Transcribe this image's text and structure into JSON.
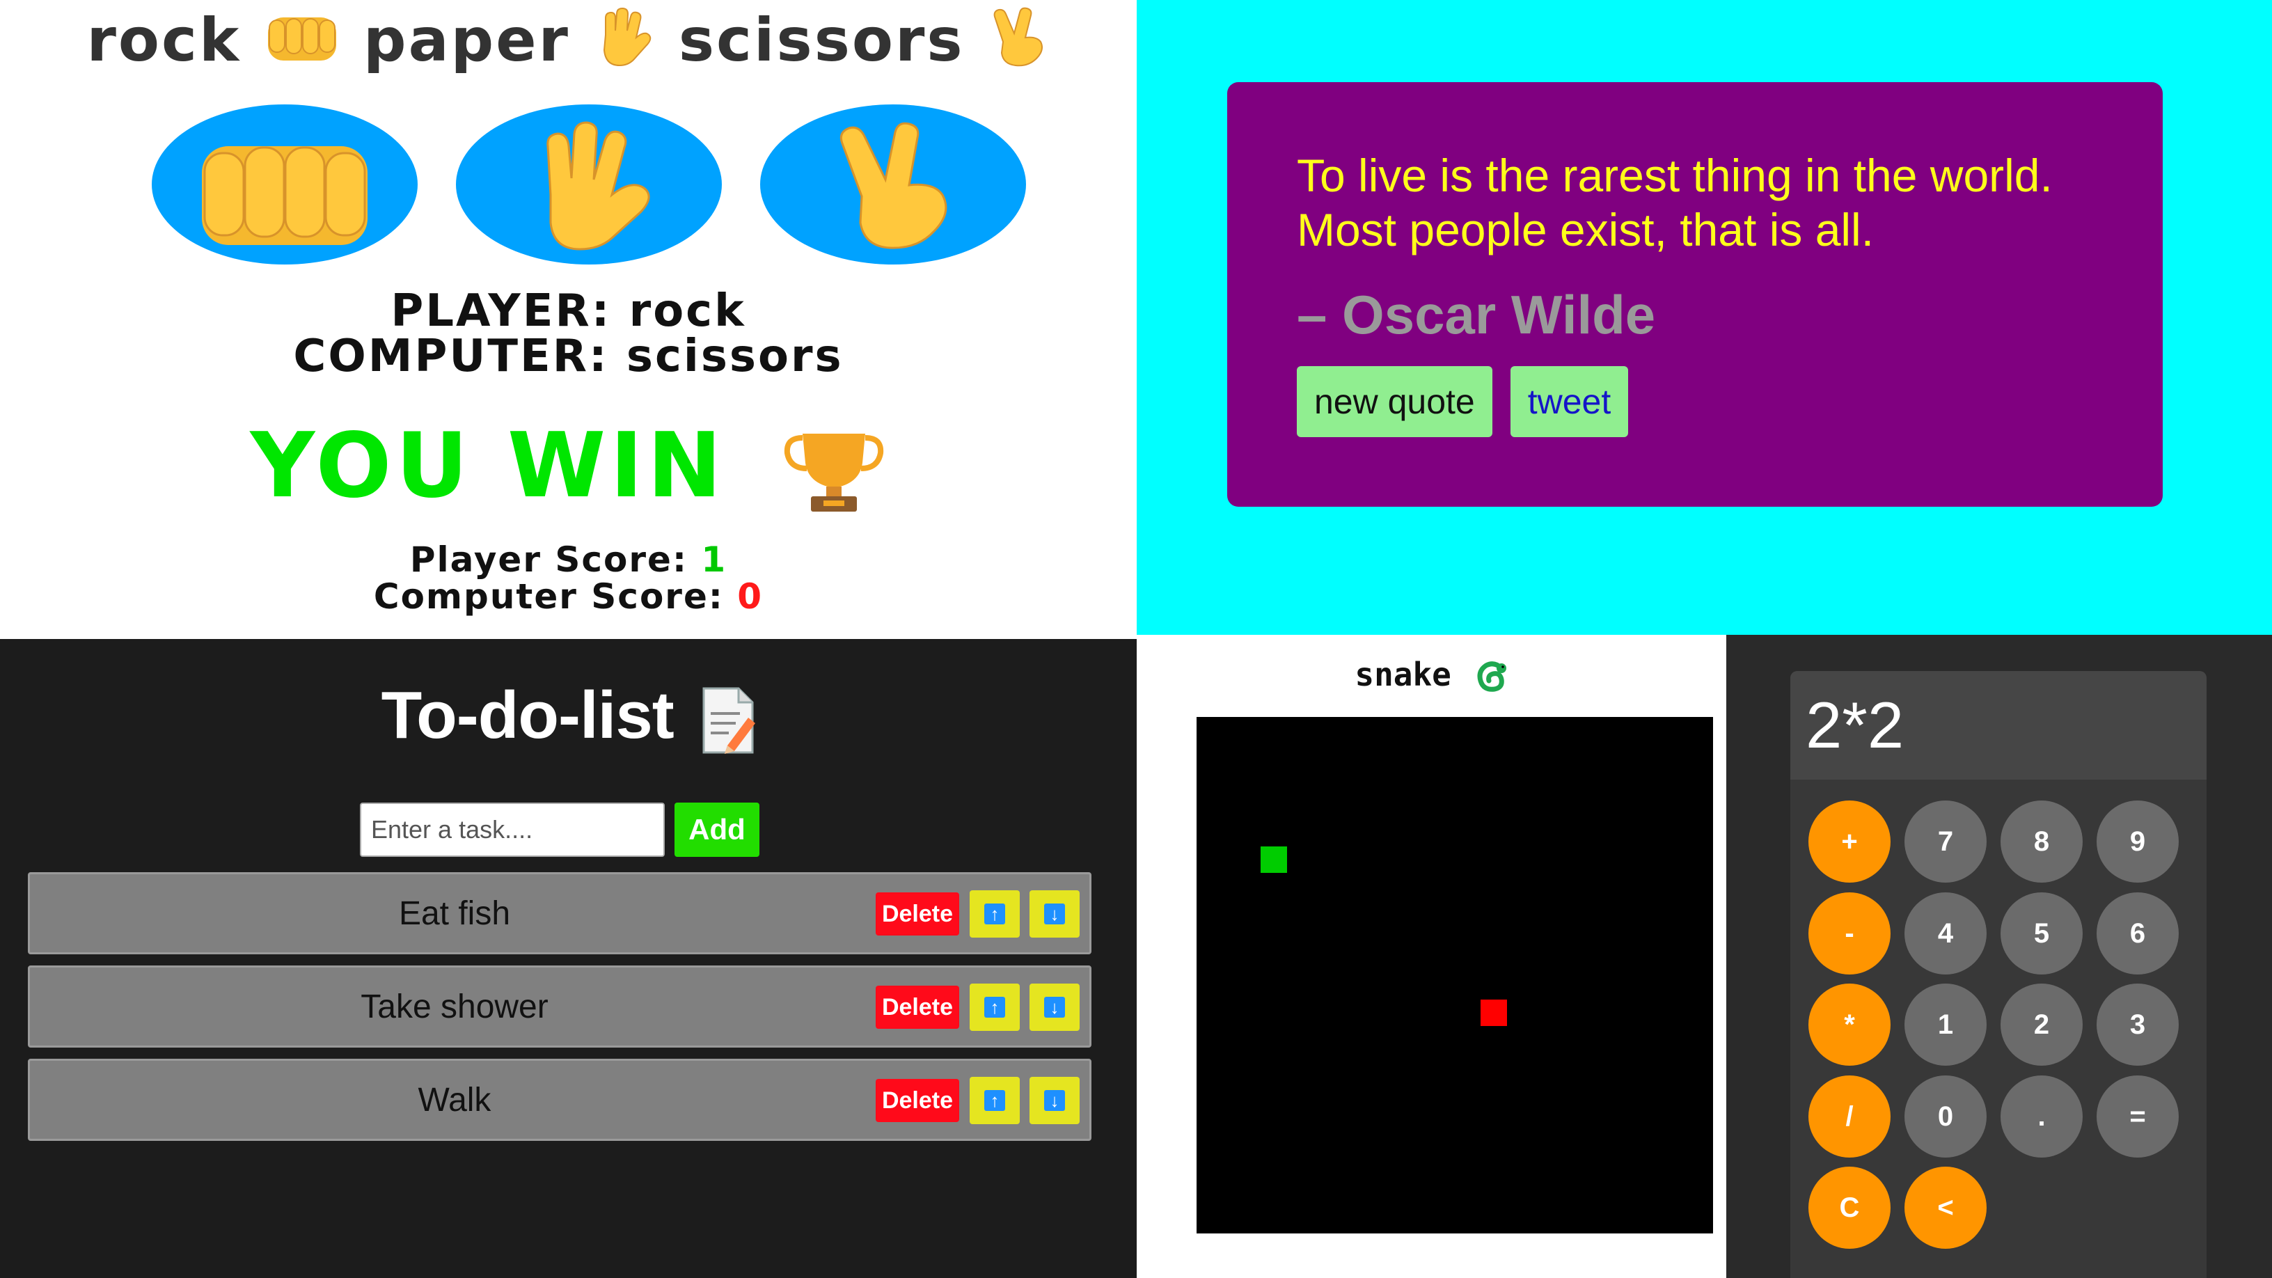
{
  "rps": {
    "title_words": [
      "rock",
      "paper",
      "scissors"
    ],
    "player_label": "PLAYER:",
    "player_choice": "rock",
    "computer_label": "COMPUTER:",
    "computer_choice": "scissors",
    "result": "YOU WIN",
    "player_score_label": "Player Score:",
    "player_score": "1",
    "computer_score_label": "Computer Score:",
    "computer_score": "0",
    "colors": {
      "button": "#00a2ff",
      "win": "#00e600",
      "player_score": "#00c800",
      "computer_score": "#ff1a1a"
    },
    "icons": [
      "fist-icon",
      "hand-icon",
      "victory-hand-icon",
      "trophy-icon"
    ]
  },
  "quote": {
    "text": "To live is the rarest thing in the world. Most people exist, that is all.",
    "author": "– Oscar Wilde",
    "new_quote_label": "new quote",
    "tweet_label": "tweet",
    "colors": {
      "background": "#00ffff",
      "card": "#800080",
      "text": "#ffff1a",
      "button": "#90ee90"
    }
  },
  "todo": {
    "title": "To-do-list",
    "input_placeholder": "Enter a task....",
    "add_label": "Add",
    "delete_label": "Delete",
    "up_arrow": "↑",
    "down_arrow": "↓",
    "items": [
      {
        "text": "Eat fish"
      },
      {
        "text": "Take shower"
      },
      {
        "text": "Walk"
      }
    ],
    "icons": [
      "memo-icon",
      "up-arrow-icon",
      "down-arrow-icon"
    ]
  },
  "snake": {
    "title": "snake",
    "icons": [
      "snake-icon"
    ],
    "colors": {
      "board": "#000000",
      "snake": "#00cc00",
      "food": "#ff0000"
    }
  },
  "calculator": {
    "display": "2*2",
    "keys": [
      "+",
      "7",
      "8",
      "9",
      "-",
      "4",
      "5",
      "6",
      "*",
      "1",
      "2",
      "3",
      "/",
      "0",
      ".",
      "=",
      "C",
      "<"
    ],
    "colors": {
      "operator": "#ff9500",
      "number": "#6b6b6b"
    }
  }
}
